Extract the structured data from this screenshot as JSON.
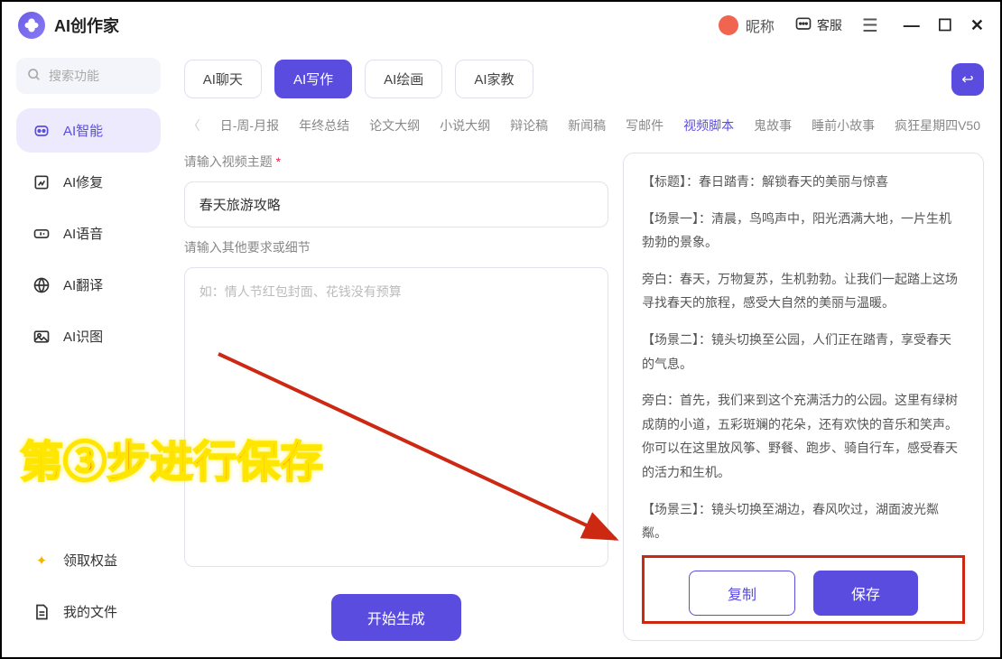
{
  "app": {
    "title": "AI创作家"
  },
  "user": {
    "nickname": "昵称"
  },
  "customerService": "客服",
  "search": {
    "placeholder": "搜索功能"
  },
  "sidebar": {
    "items": [
      {
        "label": "AI智能"
      },
      {
        "label": "AI修复"
      },
      {
        "label": "AI语音"
      },
      {
        "label": "AI翻译"
      },
      {
        "label": "AI识图"
      }
    ],
    "bottom": [
      {
        "label": "领取权益"
      },
      {
        "label": "我的文件"
      }
    ]
  },
  "tabs": [
    {
      "label": "AI聊天"
    },
    {
      "label": "AI写作"
    },
    {
      "label": "AI绘画"
    },
    {
      "label": "AI家教"
    }
  ],
  "subtabs": [
    "日-周-月报",
    "年终总结",
    "论文大纲",
    "小说大纲",
    "辩论稿",
    "新闻稿",
    "写邮件",
    "视频脚本",
    "鬼故事",
    "睡前小故事",
    "疯狂星期四V50"
  ],
  "form": {
    "topicLabel": "请输入视频主题",
    "topicValue": "春天旅游攻略",
    "detailLabel": "请输入其他要求或细节",
    "detailPlaceholder": "如：情人节红包封面、花钱没有预算",
    "generate": "开始生成"
  },
  "output": {
    "p1": "【标题】：春日踏青：解锁春天的美丽与惊喜",
    "p2": "【场景一】：清晨，鸟鸣声中，阳光洒满大地，一片生机勃勃的景象。",
    "p3": "旁白：春天，万物复苏，生机勃勃。让我们一起踏上这场寻找春天的旅程，感受大自然的美丽与温暖。",
    "p4": "【场景二】：镜头切换至公园，人们正在踏青，享受春天的气息。",
    "p5": "旁白：首先，我们来到这个充满活力的公园。这里有绿树成荫的小道，五彩斑斓的花朵，还有欢快的音乐和笑声。你可以在这里放风筝、野餐、跑步、骑自行车，感受春天的活力和生机。",
    "p6": "【场景三】：镜头切换至湖边，春风吹过，湖面波光粼粼。"
  },
  "actions": {
    "copy": "复制",
    "save": "保存"
  },
  "annotation": "第③步进行保存"
}
